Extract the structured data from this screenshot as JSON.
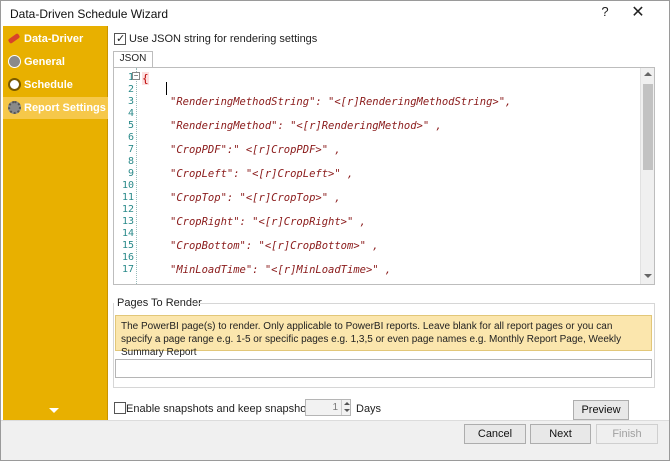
{
  "window": {
    "title": "Data-Driven Schedule Wizard",
    "help_label": "?",
    "close_label": "✕"
  },
  "sidebar": {
    "items": [
      {
        "label": "Data-Driver",
        "icon": "pencil-icon",
        "selected": false
      },
      {
        "label": "General",
        "icon": "info-icon",
        "selected": false
      },
      {
        "label": "Schedule",
        "icon": "clock-icon",
        "selected": false
      },
      {
        "label": "Report Settings",
        "icon": "gear-icon",
        "selected": true
      }
    ]
  },
  "json_option": {
    "label": "Use JSON string for rendering settings",
    "checked": true
  },
  "tab": {
    "label": "JSON"
  },
  "editor": {
    "lines": [
      {
        "num": "1",
        "text": "{"
      },
      {
        "num": "2",
        "text": ""
      },
      {
        "num": "3",
        "text": "\"RenderingMethodString\": \"<[r]RenderingMethodString>\","
      },
      {
        "num": "4",
        "text": ""
      },
      {
        "num": "5",
        "text": "\"RenderingMethod\": \"<[r]RenderingMethod>\" ,"
      },
      {
        "num": "6",
        "text": ""
      },
      {
        "num": "7",
        "text": "\"CropPDF\":\" <[r]CropPDF>\" ,"
      },
      {
        "num": "8",
        "text": ""
      },
      {
        "num": "9",
        "text": "\"CropLeft\": \"<[r]CropLeft>\" ,"
      },
      {
        "num": "10",
        "text": ""
      },
      {
        "num": "11",
        "text": "\"CropTop\": \"<[r]CropTop>\" ,"
      },
      {
        "num": "12",
        "text": ""
      },
      {
        "num": "13",
        "text": "\"CropRight\": \"<[r]CropRight>\" ,"
      },
      {
        "num": "14",
        "text": ""
      },
      {
        "num": "15",
        "text": "\"CropBottom\": \"<[r]CropBottom>\" ,"
      },
      {
        "num": "16",
        "text": ""
      },
      {
        "num": "17",
        "text": "\"MinLoadTime\": \"<[r]MinLoadTime>\" ,"
      }
    ]
  },
  "pages_to_render": {
    "title": "Pages To Render",
    "info": "The PowerBI page(s) to render. Only applicable to PowerBI reports. Leave blank for all report pages or you can specify a page range e.g. 1-5 or specific pages e.g. 1,3,5 or even page names e.g. Monthly Report Page, Weekly Summary Report",
    "value": ""
  },
  "snapshots": {
    "label": "Enable snapshots and keep snapshots for",
    "checked": false,
    "days_value": "1",
    "days_label": "Days"
  },
  "buttons": {
    "preview": "Preview",
    "cancel": "Cancel",
    "next": "Next",
    "finish": "Finish"
  },
  "colors": {
    "sidebar": "#e8b000",
    "sidebar_selected": "#f6c84a",
    "info_bg": "#fbe6ad",
    "code_string": "#8a1a1a",
    "line_number": "#2a8a8a"
  }
}
